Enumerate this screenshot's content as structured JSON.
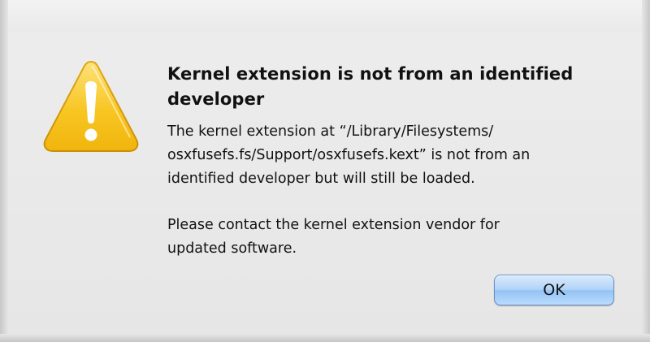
{
  "dialog": {
    "title": "Kernel extension is not from an identified developer",
    "message_paragraph_1": "The kernel extension at “/Library/Filesystems/\nosxfusefs.fs/Support/osxfusefs.kext” is not from an\nidentified developer but will still be loaded.",
    "message_paragraph_2": "Please contact the kernel extension vendor for\nupdated software.",
    "icon": "warning-triangle-icon",
    "ok_label": "OK"
  },
  "colors": {
    "background": "#ececec",
    "warning_yellow": "#f7c21b",
    "button_blue": "#a9d0f8"
  }
}
